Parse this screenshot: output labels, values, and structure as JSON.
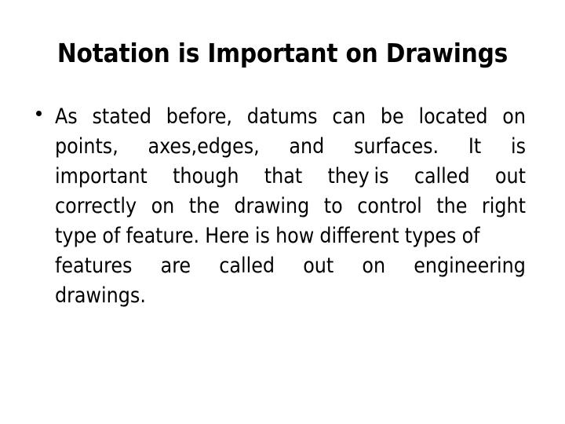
{
  "slide": {
    "title": "Notation is Important on Drawings",
    "background_color": "#ffffff",
    "text_color": "#000000",
    "bullet_glyph": "•",
    "body_paragraph": "As stated before, datums can be located on points, axes,edges, and surfaces. It is important though that they is called out correctly on the drawing to control the right type of feature. Here is how different types of features are called out on engineering drawings.",
    "body_lines": [
      {
        "align": "justify",
        "words": [
          "As",
          "stated",
          "before,",
          "datums",
          "can",
          "be",
          "located",
          "on"
        ]
      },
      {
        "align": "justify",
        "words": [
          "points,",
          "axes,edges,",
          "and",
          "surfaces.",
          "It",
          "is"
        ]
      },
      {
        "align": "justify",
        "words": [
          "important",
          "though",
          "that",
          "they is",
          "called",
          "out"
        ]
      },
      {
        "align": "justify",
        "words": [
          "correctly",
          "on",
          "the",
          "drawing",
          "to",
          "control",
          "the",
          "right"
        ]
      },
      {
        "align": "natural",
        "words": [
          "type",
          "of",
          "feature.",
          "Here",
          "is",
          "how",
          "different",
          "types",
          "of"
        ]
      },
      {
        "align": "justify",
        "words": [
          "features",
          "are",
          "called",
          "out",
          "on",
          "engineering"
        ]
      },
      {
        "align": "natural",
        "words": [
          "drawings."
        ]
      }
    ]
  }
}
